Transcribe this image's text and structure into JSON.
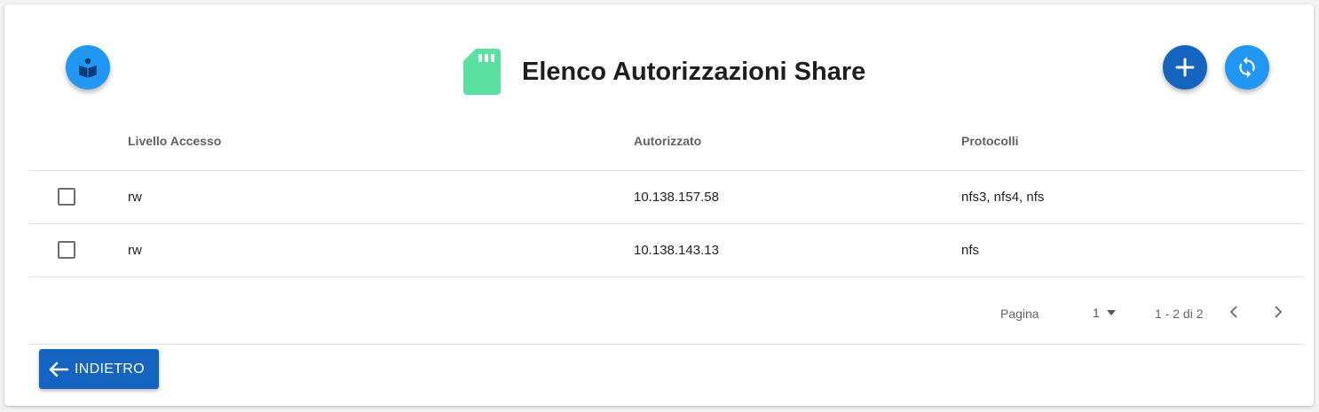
{
  "header": {
    "title": "Elenco Autorizzazioni Share",
    "icons": {
      "help": "book-reader-icon",
      "title": "sd-card-icon",
      "add": "plus-icon",
      "refresh": "refresh-icon"
    },
    "colors": {
      "primary": "#1565c0",
      "accent": "#2196f3",
      "title_icon": "#5ae1a2"
    }
  },
  "table": {
    "columns": [
      "Livello Accesso",
      "Autorizzato",
      "Protocolli"
    ],
    "rows": [
      {
        "access": "rw",
        "authorized": "10.138.157.58",
        "protocols": "nfs3, nfs4, nfs",
        "checked": false
      },
      {
        "access": "rw",
        "authorized": "10.138.143.13",
        "protocols": "nfs",
        "checked": false
      }
    ]
  },
  "pagination": {
    "page_label": "Pagina",
    "page_value": "1",
    "range": "1 - 2 di 2"
  },
  "footer": {
    "back_label": "INDIETRO"
  }
}
